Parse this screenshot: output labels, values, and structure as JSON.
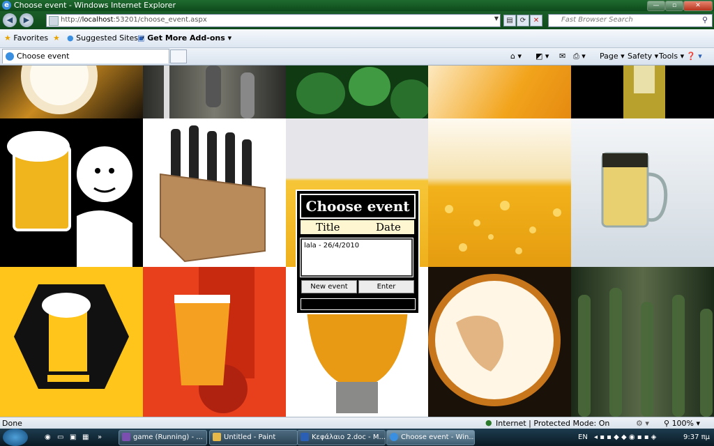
{
  "window": {
    "title": "Choose event - Windows Internet Explorer",
    "minimize": "—",
    "maximize": "▫",
    "close": "✕"
  },
  "address": {
    "url_prefix": "http://",
    "url_host": "localhost",
    "url_rest": ":53201/choose_event.aspx",
    "search_placeholder": "Fast Browser Search"
  },
  "favorites": {
    "favorites_label": "Favorites",
    "suggested_label": "Suggested Sites",
    "addons_label": "Get More Add-ons"
  },
  "tabs": {
    "active_label": "Choose event"
  },
  "commands": {
    "page": "Page",
    "safety": "Safety",
    "tools": "Tools"
  },
  "dialog": {
    "title": "Choose event",
    "col_title": "Title",
    "col_date": "Date",
    "events": [
      "lala - 26/4/2010"
    ],
    "new_event_button": "New event",
    "enter_button": "Enter"
  },
  "status": {
    "left": "Done",
    "zone": "Internet | Protected Mode: On",
    "zoom": "100%"
  },
  "taskbar": {
    "items": [
      {
        "label": "game (Running) - ...",
        "color": "#7a4fb0"
      },
      {
        "label": "Untitled - Paint",
        "color": "#e6b84a"
      },
      {
        "label": "Κεφάλαιο 2.doc - M...",
        "color": "#2b5fb5"
      },
      {
        "label": "Choose event - Win...",
        "color": "#3b8fe0"
      }
    ],
    "lang": "EN",
    "time": "9:37 πμ"
  },
  "colors": {
    "beer_gold": "#f2b21a",
    "tile_yellow": "#ffc51a",
    "tile_red": "#e8401c",
    "dialog_header": "#fdf6d0"
  }
}
